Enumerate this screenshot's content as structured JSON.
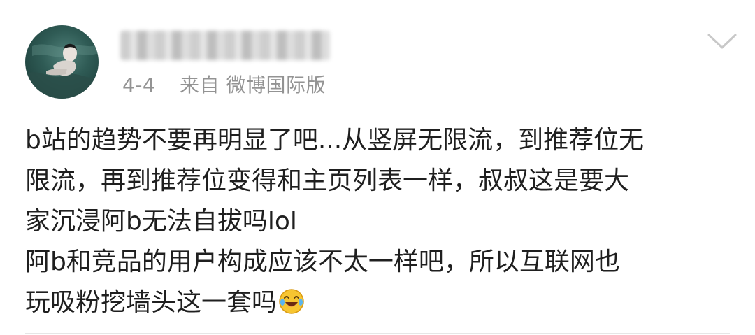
{
  "post": {
    "date": "4-4",
    "source": "来自 微博国际版",
    "content_lines": [
      "b站的趋势不要再明显了吧...从竖屏无限流，到推荐位无",
      "限流，再到推荐位变得和主页列表一样，叔叔这是要大",
      "家沉浸阿b无法自拔吗lol",
      "阿b和竞品的用户构成应该不太一样吧，所以互联网也",
      "玩吸粉挖墙头这一套吗"
    ]
  },
  "icons": {
    "avatar": "user-avatar",
    "more": "chevron-down-icon",
    "emoji": "laugh-cry-emoji-icon"
  },
  "colors": {
    "meta_text": "#939393",
    "body_text": "#1f1f1f",
    "divider": "#e6e6e6",
    "chevron": "#c8c8c8"
  }
}
